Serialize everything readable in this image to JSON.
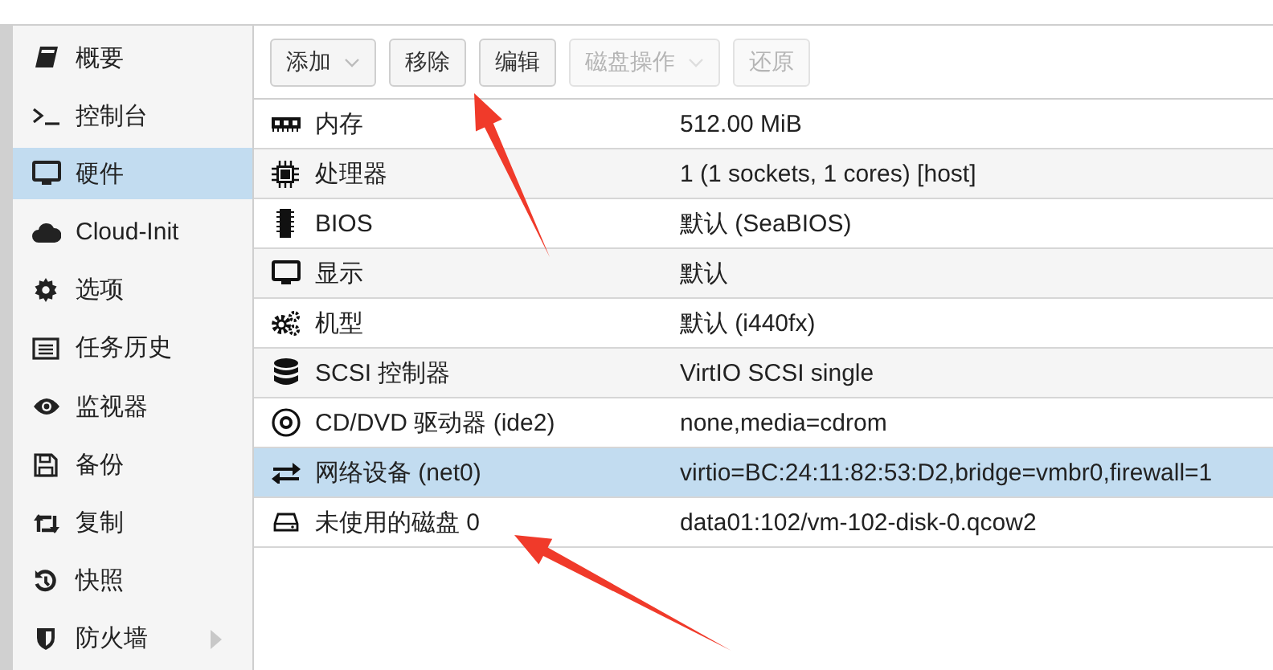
{
  "sidebar": {
    "items": [
      {
        "label": "概要",
        "selected": false,
        "expandable": false
      },
      {
        "label": "控制台",
        "selected": false,
        "expandable": false
      },
      {
        "label": "硬件",
        "selected": true,
        "expandable": false
      },
      {
        "label": "Cloud-Init",
        "selected": false,
        "expandable": false
      },
      {
        "label": "选项",
        "selected": false,
        "expandable": false
      },
      {
        "label": "任务历史",
        "selected": false,
        "expandable": false
      },
      {
        "label": "监视器",
        "selected": false,
        "expandable": false
      },
      {
        "label": "备份",
        "selected": false,
        "expandable": false
      },
      {
        "label": "复制",
        "selected": false,
        "expandable": false
      },
      {
        "label": "快照",
        "selected": false,
        "expandable": false
      },
      {
        "label": "防火墙",
        "selected": false,
        "expandable": true
      }
    ]
  },
  "toolbar": {
    "buttons": [
      {
        "label": "添加",
        "dropdown": true,
        "disabled": false
      },
      {
        "label": "移除",
        "dropdown": false,
        "disabled": false
      },
      {
        "label": "编辑",
        "dropdown": false,
        "disabled": false
      },
      {
        "label": "磁盘操作",
        "dropdown": true,
        "disabled": true
      },
      {
        "label": "还原",
        "dropdown": false,
        "disabled": true
      }
    ]
  },
  "table": {
    "rows": [
      {
        "name": "内存",
        "value": "512.00 MiB",
        "selected": false
      },
      {
        "name": "处理器",
        "value": "1 (1 sockets, 1 cores) [host]",
        "selected": false
      },
      {
        "name": "BIOS",
        "value": "默认 (SeaBIOS)",
        "selected": false
      },
      {
        "name": "显示",
        "value": "默认",
        "selected": false
      },
      {
        "name": "机型",
        "value": "默认 (i440fx)",
        "selected": false
      },
      {
        "name": "SCSI 控制器",
        "value": "VirtIO SCSI single",
        "selected": false
      },
      {
        "name": "CD/DVD 驱动器 (ide2)",
        "value": "none,media=cdrom",
        "selected": false
      },
      {
        "name": "网络设备 (net0)",
        "value": "virtio=BC:24:11:82:53:D2,bridge=vmbr0,firewall=1",
        "selected": true
      },
      {
        "name": "未使用的磁盘 0",
        "value": "data01:102/vm-102-disk-0.qcow2",
        "selected": false
      }
    ]
  },
  "annotations": [
    {
      "kind": "arrow"
    },
    {
      "kind": "arrow"
    }
  ]
}
